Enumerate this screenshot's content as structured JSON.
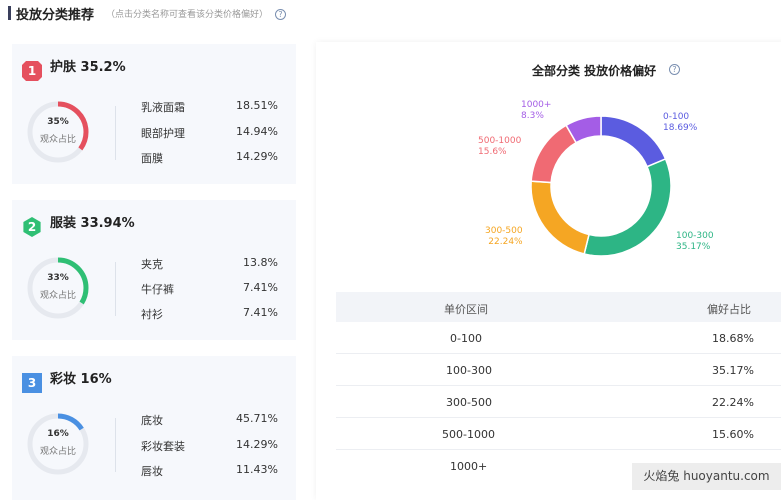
{
  "header": {
    "title": "投放分类推荐",
    "subtitle": "（点击分类名称可查看该分类价格偏好）"
  },
  "colors": {
    "accent_red": "#e5505e",
    "accent_green": "#2fbf74",
    "accent_blue": "#4a90e2",
    "ring_track": "#e6e9ef",
    "slice_0_100": "#5b5ce0",
    "slice_100_300": "#2db585",
    "slice_300_500": "#f5a623",
    "slice_500_1000": "#f06a73",
    "slice_1000_plus": "#a45de6"
  },
  "categories": [
    {
      "rank": "1",
      "title": "护肤 35.2%",
      "audience_pct_label": "35%",
      "audience_pct": 35.2,
      "audience_label": "观众占比",
      "items": [
        {
          "name": "乳液面霜",
          "value": "18.51%"
        },
        {
          "name": "眼部护理",
          "value": "14.94%"
        },
        {
          "name": "面膜",
          "value": "14.29%"
        }
      ]
    },
    {
      "rank": "2",
      "title": "服装 33.94%",
      "audience_pct_label": "33%",
      "audience_pct": 33.94,
      "audience_label": "观众占比",
      "items": [
        {
          "name": "夹克",
          "value": "13.8%"
        },
        {
          "name": "牛仔裤",
          "value": "7.41%"
        },
        {
          "name": "衬衫",
          "value": "7.41%"
        }
      ]
    },
    {
      "rank": "3",
      "title": "彩妆 16%",
      "audience_pct_label": "16%",
      "audience_pct": 16,
      "audience_label": "观众占比",
      "items": [
        {
          "name": "底妆",
          "value": "45.71%"
        },
        {
          "name": "彩妆套装",
          "value": "14.29%"
        },
        {
          "name": "唇妆",
          "value": "11.43%"
        }
      ]
    }
  ],
  "price_chart": {
    "title": "全部分类 投放价格偏好"
  },
  "chart_data": {
    "type": "pie",
    "title": "全部分类 投放价格偏好",
    "slices": [
      {
        "label": "0-100",
        "value": 18.69,
        "value_label": "18.69%"
      },
      {
        "label": "100-300",
        "value": 35.17,
        "value_label": "35.17%"
      },
      {
        "label": "300-500",
        "value": 22.24,
        "value_label": "22.24%"
      },
      {
        "label": "500-1000",
        "value": 15.6,
        "value_label": "15.6%"
      },
      {
        "label": "1000+",
        "value": 8.3,
        "value_label": "8.3%"
      }
    ]
  },
  "table": {
    "headers": [
      "单价区间",
      "偏好占比"
    ],
    "rows": [
      {
        "range": "0-100",
        "pct": "18.68%"
      },
      {
        "range": "100-300",
        "pct": "35.17%"
      },
      {
        "range": "300-500",
        "pct": "22.24%"
      },
      {
        "range": "500-1000",
        "pct": "15.60%"
      },
      {
        "range": "1000+",
        "pct": ""
      }
    ]
  },
  "watermark": "火焰兔 huoyantu.com"
}
